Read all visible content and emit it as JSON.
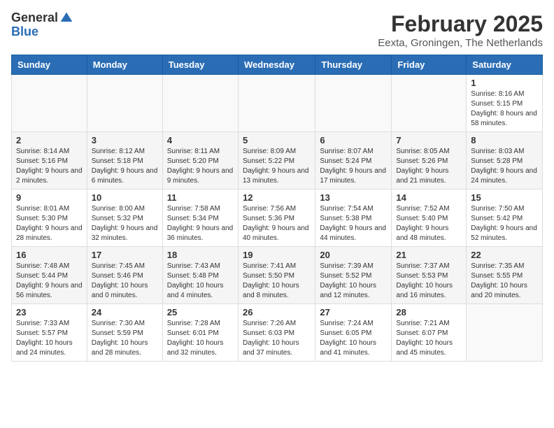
{
  "header": {
    "logo_general": "General",
    "logo_blue": "Blue",
    "month_title": "February 2025",
    "subtitle": "Eexta, Groningen, The Netherlands"
  },
  "weekdays": [
    "Sunday",
    "Monday",
    "Tuesday",
    "Wednesday",
    "Thursday",
    "Friday",
    "Saturday"
  ],
  "weeks": [
    [
      {
        "day": "",
        "info": ""
      },
      {
        "day": "",
        "info": ""
      },
      {
        "day": "",
        "info": ""
      },
      {
        "day": "",
        "info": ""
      },
      {
        "day": "",
        "info": ""
      },
      {
        "day": "",
        "info": ""
      },
      {
        "day": "1",
        "info": "Sunrise: 8:16 AM\nSunset: 5:15 PM\nDaylight: 8 hours and 58 minutes."
      }
    ],
    [
      {
        "day": "2",
        "info": "Sunrise: 8:14 AM\nSunset: 5:16 PM\nDaylight: 9 hours and 2 minutes."
      },
      {
        "day": "3",
        "info": "Sunrise: 8:12 AM\nSunset: 5:18 PM\nDaylight: 9 hours and 6 minutes."
      },
      {
        "day": "4",
        "info": "Sunrise: 8:11 AM\nSunset: 5:20 PM\nDaylight: 9 hours and 9 minutes."
      },
      {
        "day": "5",
        "info": "Sunrise: 8:09 AM\nSunset: 5:22 PM\nDaylight: 9 hours and 13 minutes."
      },
      {
        "day": "6",
        "info": "Sunrise: 8:07 AM\nSunset: 5:24 PM\nDaylight: 9 hours and 17 minutes."
      },
      {
        "day": "7",
        "info": "Sunrise: 8:05 AM\nSunset: 5:26 PM\nDaylight: 9 hours and 21 minutes."
      },
      {
        "day": "8",
        "info": "Sunrise: 8:03 AM\nSunset: 5:28 PM\nDaylight: 9 hours and 24 minutes."
      }
    ],
    [
      {
        "day": "9",
        "info": "Sunrise: 8:01 AM\nSunset: 5:30 PM\nDaylight: 9 hours and 28 minutes."
      },
      {
        "day": "10",
        "info": "Sunrise: 8:00 AM\nSunset: 5:32 PM\nDaylight: 9 hours and 32 minutes."
      },
      {
        "day": "11",
        "info": "Sunrise: 7:58 AM\nSunset: 5:34 PM\nDaylight: 9 hours and 36 minutes."
      },
      {
        "day": "12",
        "info": "Sunrise: 7:56 AM\nSunset: 5:36 PM\nDaylight: 9 hours and 40 minutes."
      },
      {
        "day": "13",
        "info": "Sunrise: 7:54 AM\nSunset: 5:38 PM\nDaylight: 9 hours and 44 minutes."
      },
      {
        "day": "14",
        "info": "Sunrise: 7:52 AM\nSunset: 5:40 PM\nDaylight: 9 hours and 48 minutes."
      },
      {
        "day": "15",
        "info": "Sunrise: 7:50 AM\nSunset: 5:42 PM\nDaylight: 9 hours and 52 minutes."
      }
    ],
    [
      {
        "day": "16",
        "info": "Sunrise: 7:48 AM\nSunset: 5:44 PM\nDaylight: 9 hours and 56 minutes."
      },
      {
        "day": "17",
        "info": "Sunrise: 7:45 AM\nSunset: 5:46 PM\nDaylight: 10 hours and 0 minutes."
      },
      {
        "day": "18",
        "info": "Sunrise: 7:43 AM\nSunset: 5:48 PM\nDaylight: 10 hours and 4 minutes."
      },
      {
        "day": "19",
        "info": "Sunrise: 7:41 AM\nSunset: 5:50 PM\nDaylight: 10 hours and 8 minutes."
      },
      {
        "day": "20",
        "info": "Sunrise: 7:39 AM\nSunset: 5:52 PM\nDaylight: 10 hours and 12 minutes."
      },
      {
        "day": "21",
        "info": "Sunrise: 7:37 AM\nSunset: 5:53 PM\nDaylight: 10 hours and 16 minutes."
      },
      {
        "day": "22",
        "info": "Sunrise: 7:35 AM\nSunset: 5:55 PM\nDaylight: 10 hours and 20 minutes."
      }
    ],
    [
      {
        "day": "23",
        "info": "Sunrise: 7:33 AM\nSunset: 5:57 PM\nDaylight: 10 hours and 24 minutes."
      },
      {
        "day": "24",
        "info": "Sunrise: 7:30 AM\nSunset: 5:59 PM\nDaylight: 10 hours and 28 minutes."
      },
      {
        "day": "25",
        "info": "Sunrise: 7:28 AM\nSunset: 6:01 PM\nDaylight: 10 hours and 32 minutes."
      },
      {
        "day": "26",
        "info": "Sunrise: 7:26 AM\nSunset: 6:03 PM\nDaylight: 10 hours and 37 minutes."
      },
      {
        "day": "27",
        "info": "Sunrise: 7:24 AM\nSunset: 6:05 PM\nDaylight: 10 hours and 41 minutes."
      },
      {
        "day": "28",
        "info": "Sunrise: 7:21 AM\nSunset: 6:07 PM\nDaylight: 10 hours and 45 minutes."
      },
      {
        "day": "",
        "info": ""
      }
    ]
  ]
}
